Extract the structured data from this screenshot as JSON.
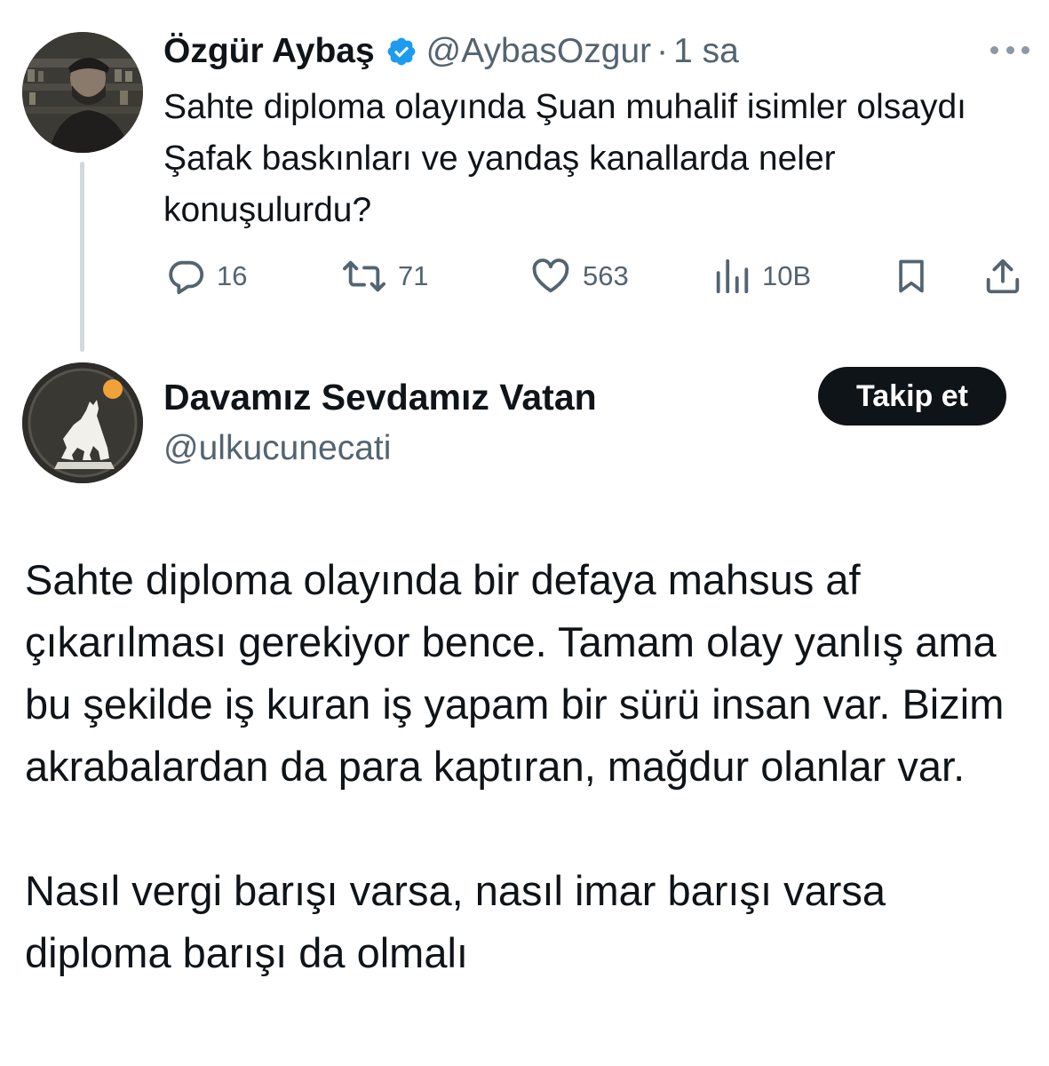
{
  "quoted_tweet": {
    "author_name": "Özgür Aybaş",
    "verified": true,
    "handle": "@AybasOzgur",
    "separator": "·",
    "time": "1 sa",
    "text": "Sahte diploma olayında Şuan muhalif isimler olsaydı Şafak baskınları ve yandaş kanallarda neler konuşulurdu?",
    "actions": {
      "replies": "16",
      "retweets": "71",
      "likes": "563",
      "views": "10B"
    },
    "icons": [
      "more-icon",
      "reply-icon",
      "retweet-icon",
      "like-icon",
      "views-icon",
      "bookmark-icon",
      "share-icon",
      "verified-badge-icon"
    ]
  },
  "reply_tweet": {
    "author_name": "Davamız Sevdamız Vatan",
    "handle": "@ulkucunecati",
    "follow_label": "Takip et",
    "paragraphs": [
      "Sahte diploma olayında bir defaya mahsus af çıkarılması gerekiyor bence. Tamam olay yanlış ama bu şekilde iş kuran iş yapam bir sürü insan var. Bizim akrabalardan da para kaptıran, mağdur olanlar var.",
      "Nasıl vergi barışı varsa, nasıl imar barışı varsa diploma barışı da olmalı"
    ]
  },
  "colors": {
    "text_primary": "#0f1419",
    "text_secondary": "#536471",
    "verified_blue": "#1d9bf0",
    "thread_line": "#cfd9de",
    "follow_button_bg": "#0f1419"
  }
}
